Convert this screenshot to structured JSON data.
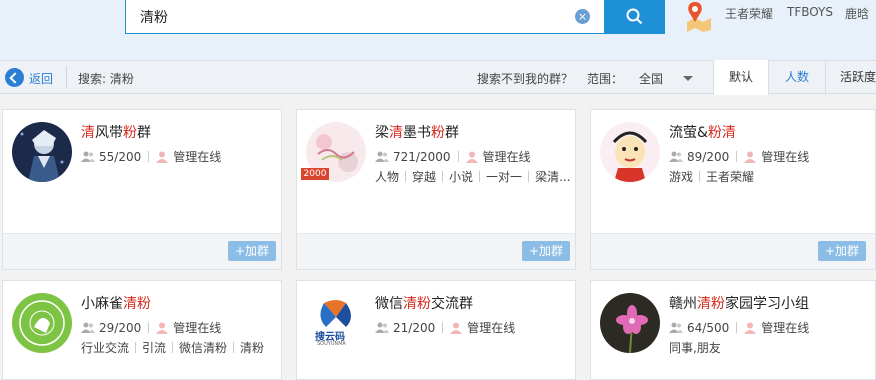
{
  "search": {
    "query": "清粉",
    "clear_icon": "clear-icon",
    "button_icon": "search-icon"
  },
  "hot_tags": [
    "王者荣耀",
    "TFBOYS",
    "鹿晗"
  ],
  "filter": {
    "back_label": "返回",
    "summary": "搜索: 清粉",
    "not_found": "搜索不到我的群？",
    "range_label": "范围：",
    "range_value": "全国",
    "sort_tabs": [
      "默认",
      "人数",
      "活跃度"
    ]
  },
  "join_label": "+加群",
  "admin_status": "管理在线",
  "cards": [
    {
      "name_parts": [
        {
          "t": "清",
          "h": true
        },
        {
          "t": "风带",
          "h": false
        },
        {
          "t": "粉",
          "h": true
        },
        {
          "t": "群",
          "h": false
        }
      ],
      "members": "55/200",
      "tags": []
    },
    {
      "name_parts": [
        {
          "t": "梁",
          "h": false
        },
        {
          "t": "清",
          "h": true
        },
        {
          "t": "墨书",
          "h": false
        },
        {
          "t": "粉",
          "h": true
        },
        {
          "t": "群",
          "h": false
        }
      ],
      "members": "721/2000",
      "tags": [
        "人物",
        "穿越",
        "小说",
        "一对一",
        "梁清..."
      ],
      "badge": "2000"
    },
    {
      "name_parts": [
        {
          "t": "流萤&",
          "h": false
        },
        {
          "t": "粉",
          "h": true
        },
        {
          "t": "清",
          "h": true
        }
      ],
      "members": "89/200",
      "tags": [
        "游戏",
        "王者荣耀"
      ]
    },
    {
      "name_parts": [
        {
          "t": "小麻雀",
          "h": false
        },
        {
          "t": "清粉",
          "h": true
        }
      ],
      "members": "29/200",
      "tags": [
        "行业交流",
        "引流",
        "微信清粉",
        "清粉"
      ]
    },
    {
      "name_parts": [
        {
          "t": "微信",
          "h": false
        },
        {
          "t": "清粉",
          "h": true
        },
        {
          "t": "交流群",
          "h": false
        }
      ],
      "members": "21/200",
      "tags": []
    },
    {
      "name_parts": [
        {
          "t": "赣州",
          "h": false
        },
        {
          "t": "清粉",
          "h": true
        },
        {
          "t": "家园学习小组",
          "h": false
        }
      ],
      "members": "64/500",
      "tags": [
        "同事,朋友"
      ]
    }
  ],
  "logos": {
    "card5": "搜云码",
    "card5_sub": "SOUYUNMA"
  },
  "colors": {
    "accent": "#1e90d8",
    "highlight": "#d52b1e",
    "join": "#8bbde6"
  }
}
